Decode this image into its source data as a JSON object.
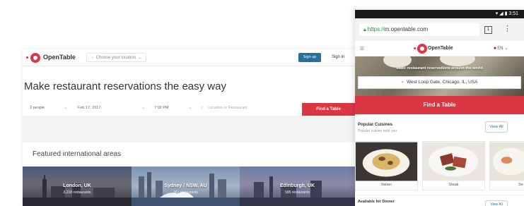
{
  "desktop": {
    "brand": "OpenTable",
    "location_placeholder": "Choose your location",
    "signup_label": "Sign up",
    "signin_label": "Sign in",
    "headline": "Make restaurant reservations the easy way",
    "search": {
      "party_size": "2 people",
      "date": "Feb 17, 2017",
      "time": "7:00 PM",
      "location_placeholder": "Location or Restaurant",
      "find_label": "Find a Table"
    },
    "featured_title": "Featured international areas",
    "areas": [
      {
        "name": "London, UK",
        "count": "3,218 restaurants"
      },
      {
        "name": "Sydney / NSW, AU",
        "count": "361 restaurants"
      },
      {
        "name": "Edinburgh, UK",
        "count": "585 restaurants"
      }
    ]
  },
  "phone": {
    "status_icons": "▾ ◢ ▮ 3:51",
    "url_scheme": "https://",
    "url_host": "m.opentable.com",
    "tab_count": "1",
    "brand": "OpenTable",
    "language": "EN",
    "hero_text": "Make restaurant reservations around the world",
    "location_value": "West Loop Gate, Chicago, IL, USA",
    "find_label": "Find a Table",
    "popular": {
      "title": "Popular Cuisines",
      "subtitle": "Popular cuisine near you",
      "view_all": "View All",
      "items": [
        {
          "label": "Italian"
        },
        {
          "label": "Steak"
        },
        {
          "label": "Se"
        }
      ]
    },
    "dinner": {
      "title": "Available for Dinner",
      "view_all": "View All"
    }
  },
  "colors": {
    "brand_red": "#da3743",
    "signup_blue": "#2a6f97"
  },
  "icons": [
    "opentable-logo-icon",
    "chevron-down-icon",
    "search-icon",
    "lock-icon",
    "tabs-icon",
    "overflow-menu-icon",
    "hamburger-icon",
    "flag-icon"
  ]
}
